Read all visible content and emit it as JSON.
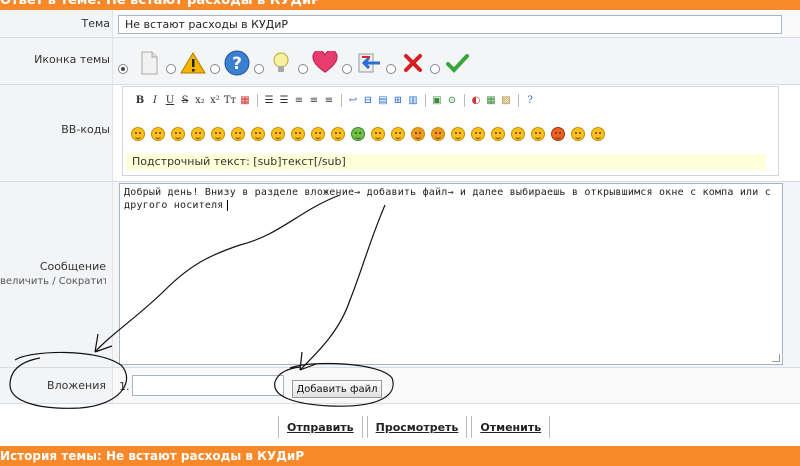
{
  "header": {
    "title": "Ответ в теме: Не встают расходы в КУДиР"
  },
  "form": {
    "subject": {
      "label": "Тема",
      "value": "Не встают расходы в КУДиР"
    },
    "topic_icon": {
      "label": "Иконка темы",
      "options": [
        "none",
        "document-icon",
        "warning-icon",
        "question-icon",
        "lightbulb-icon",
        "heart-icon",
        "redirect-icon",
        "cross-icon",
        "check-icon"
      ],
      "selected": "none"
    },
    "bbcodes": {
      "label": "BB-коды",
      "toolbar": [
        "B",
        "I",
        "U",
        "S",
        "x₂",
        "x²",
        "Tт",
        "▦",
        "☰",
        "☰",
        "≡",
        "≡",
        "≡",
        "↩",
        "⊟",
        "▤",
        "⊞",
        "▥",
        "▣",
        "⊙",
        "◐",
        "▦",
        "▨",
        "?"
      ],
      "smileys_count": 24,
      "hint": "Подстрочный текст: [sub]текст[/sub]"
    },
    "message": {
      "label": "Сообщение",
      "sub_label": "величить / Сократить",
      "text": "Добрый день! Внизу в разделе вложение→ добавить файл→ и далее выбираешь в открывшимся окне с компа или с другого носителя"
    },
    "attachments": {
      "label": "Вложения",
      "index": "1.",
      "add_button": "Добавить файл"
    },
    "buttons": {
      "send": "Отправить",
      "preview": "Просмотреть",
      "cancel": "Отменить"
    }
  },
  "footer": {
    "title": "История темы: Не встают расходы в КУДиР"
  },
  "colors": {
    "accent": "#f7892b",
    "label_bg": "#f3f4f6"
  }
}
